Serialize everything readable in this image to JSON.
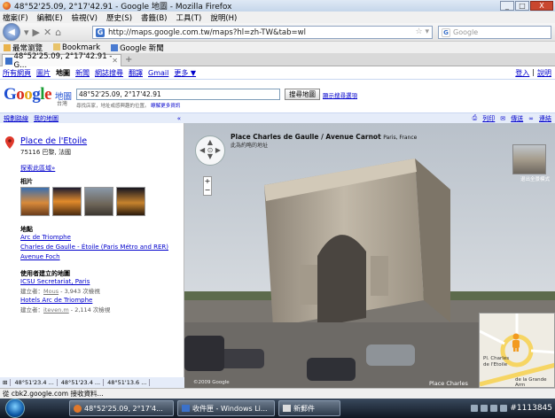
{
  "window": {
    "title": "48°52'25.09, 2°17'42.91 - Google 地圖 - Mozilla Firefox",
    "controls": [
      "_",
      "□",
      "X"
    ]
  },
  "menu": [
    "檔案(F)",
    "編輯(E)",
    "檢視(V)",
    "歷史(S)",
    "書籤(B)",
    "工具(T)",
    "說明(H)"
  ],
  "nav": {
    "url": "http://maps.google.com.tw/maps?hl=zh-TW&tab=wl",
    "search_placeholder": "Google"
  },
  "bookmarks": [
    "最常瀏覽",
    "Bookmark",
    "Google 新聞"
  ],
  "tab": {
    "label": "48°52'25.09, 2°17'42.91 - G..."
  },
  "gbar": {
    "links": [
      "所有網頁",
      "圖片",
      "地圖",
      "新聞",
      "網誌搜尋",
      "翻譯",
      "Gmail",
      "更多 ▼"
    ],
    "active": "地圖",
    "signin": "登入",
    "help": "說明"
  },
  "maps_header": {
    "logo_parts": [
      "G",
      "o",
      "o",
      "g",
      "l",
      "e"
    ],
    "product": "地圖",
    "region": "台灣",
    "query": "48°52'25.09, 2°17'42.91",
    "hint": "尋找店家，地址或感興趣的位置。",
    "hint_link": "瞭解更多資訊",
    "search_button": "搜尋地圖",
    "show_options": "顯示搜尋選項"
  },
  "left_header": {
    "directions": "規劃路線",
    "my_maps": "我的地圖",
    "collapse": "«"
  },
  "right_header": {
    "print": "列印",
    "send": "傳送",
    "link": "連結"
  },
  "place": {
    "title": "Place de l'Etoile",
    "address": "75116 巴黎, 法國",
    "explore": "探索此區域»"
  },
  "photos_label": "相片",
  "places_label": "地點",
  "places": [
    "Arc de Triomphe",
    "Charles de Gaulle - Étoile (Paris Métro and RER)",
    "Avenue Foch"
  ],
  "user_maps_label": "使用者建立的地圖",
  "user_maps": [
    {
      "title": "ICSU Secretariat, Paris",
      "creator_prefix": "建立者：",
      "creator": "Mous",
      "views": "- 3,943 次檢視"
    },
    {
      "title": "Hotels Arc de Triomphe",
      "creator_prefix": "建立者：",
      "creator": "iteven.m",
      "views": "- 2,114 次檢視"
    }
  ],
  "bottom_tabs": [
    "48°51'23.4 ...",
    "48°51'23.4 ...",
    "48°51'13.6 ..."
  ],
  "streetview": {
    "title": "Place Charles de Gaulle / Avenue Carnot",
    "locality": "Paris, France",
    "subtitle": "此為約略的地址",
    "thumb_caption": "退出全景模式",
    "copyright": "©2009 Google",
    "corner_label": "Place Charles"
  },
  "minimap": {
    "labels": [
      "Pl. Charles",
      "de l'Etoile",
      "de la Grande Arm"
    ]
  },
  "status": "從 cbk2.google.com 接收資料...",
  "taskbar": {
    "items": [
      "48°52'25.09, 2°17'4...",
      "收件匣 - Windows Li...",
      "新郵件"
    ],
    "clock": "#1113845"
  },
  "colors": {
    "link": "#0000cc",
    "header_bg": "#e5ecf9",
    "google_blue": "#1f4fd1",
    "google_red": "#d92b1b",
    "google_yellow": "#e6a711",
    "google_green": "#1a9e34"
  }
}
